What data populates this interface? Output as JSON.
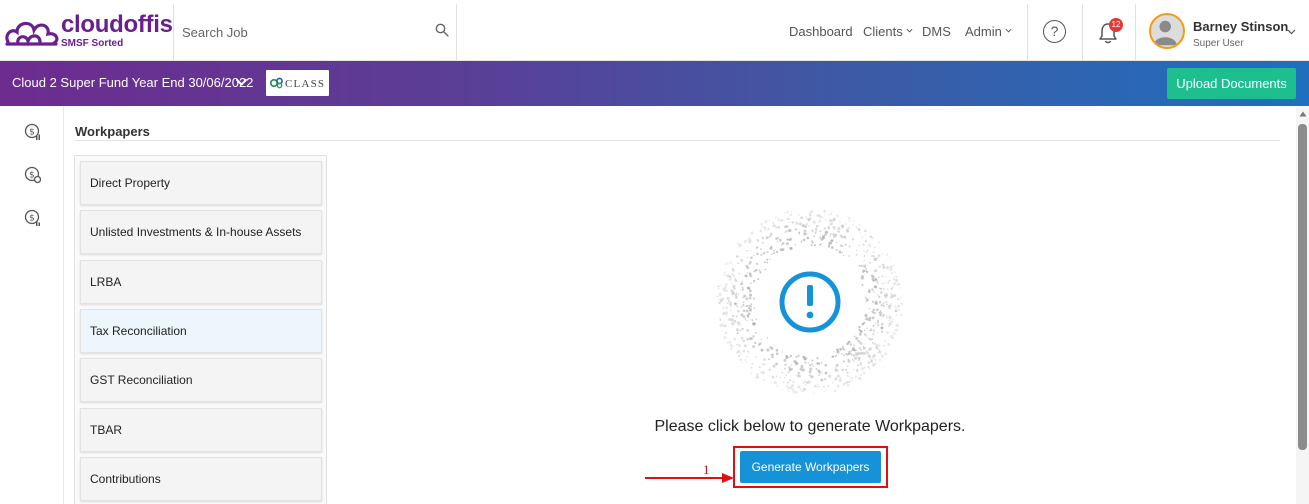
{
  "brand": {
    "name": "cloudoffis",
    "tagline": "SMSF Sorted",
    "color": "#6a1f8f"
  },
  "search": {
    "placeholder": "Search Job",
    "value": ""
  },
  "nav": [
    {
      "label": "Dashboard",
      "has_menu": false
    },
    {
      "label": "Clients",
      "has_menu": true
    },
    {
      "label": "DMS",
      "has_menu": false
    },
    {
      "label": "Admin",
      "has_menu": true
    }
  ],
  "help": {
    "glyph": "?"
  },
  "notifications": {
    "count": "12"
  },
  "user": {
    "name": "Barney Stinson",
    "role": "Super User"
  },
  "job": {
    "title": "Cloud 2 Super Fund Year End 30/06/2022",
    "integration_logo_text": "CLASS"
  },
  "toolbar": {
    "upload_label": "Upload Documents",
    "upload_color": "#1dbf8f"
  },
  "rail": {
    "icons": [
      "dollar-chart-icon",
      "dollar-settings-icon",
      "dollar-report-icon"
    ]
  },
  "workpapers": {
    "title": "Workpapers",
    "items": [
      {
        "label": "Direct Property",
        "active": false
      },
      {
        "label": "Unlisted Investments & In-house Assets",
        "active": false
      },
      {
        "label": "LRBA",
        "active": false
      },
      {
        "label": "Tax Reconciliation",
        "active": true
      },
      {
        "label": "GST Reconciliation",
        "active": false
      },
      {
        "label": "TBAR",
        "active": false
      },
      {
        "label": "Contributions",
        "active": false
      }
    ]
  },
  "empty_state": {
    "message": "Please click below to generate Workpapers.",
    "generate_label": "Generate Workpapers",
    "accent": "#1592d8"
  },
  "annotation": {
    "step": "1",
    "color": "#e01010"
  }
}
